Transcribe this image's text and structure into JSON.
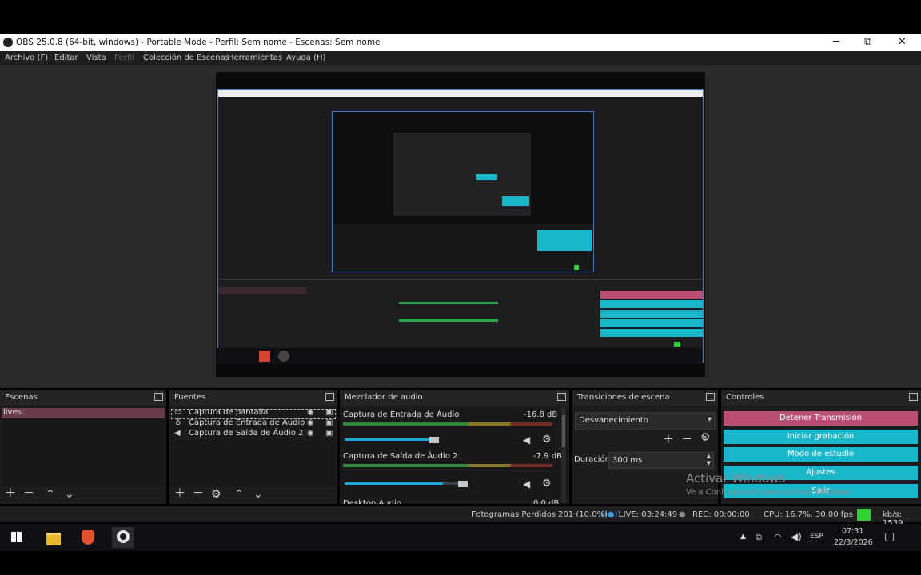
{
  "window": {
    "title": "OBS 25.0.8 (64-bit, windows) - Portable Mode - Perfil: Sem nome - Escenas: Sem nome",
    "minimize": "─",
    "maximize": "⧉",
    "close": "✕"
  },
  "menu": [
    "Archivo (F)",
    "Editar",
    "Vista",
    "Perfil",
    "Colección de Escenas",
    "Herramientas",
    "Ayuda (H)"
  ],
  "docks": {
    "scenes": {
      "title": "Escenas",
      "items": [
        "lives"
      ]
    },
    "sources": {
      "title": "Fuentes",
      "items": [
        "Captura de pantalla",
        "Captura de Entrada de Áudio",
        "Captura de Saída de Áudio 2"
      ]
    },
    "mixer": {
      "title": "Mezclador de audio",
      "channels": [
        {
          "name": "Captura de Entrada de Áudio",
          "db": "-16.8 dB",
          "volume": 0.96
        },
        {
          "name": "Captura de Saída de Áudio 2",
          "db": "-7.9 dB",
          "volume": 0.82
        },
        {
          "name": "Desktop Áudio",
          "db": "0.0 dB"
        }
      ],
      "scale": [
        "-60",
        "-55",
        "-50",
        "-45",
        "-40",
        "-35",
        "-30",
        "-25",
        "-20",
        "-15",
        "-10",
        "-5",
        "0"
      ]
    },
    "transitions": {
      "title": "Transiciones de escena",
      "selected": "Desvanecimiento",
      "duration_label": "Duración",
      "duration_value": "300 ms"
    },
    "controls": {
      "title": "Controles",
      "buttons": [
        "Detener Transmisión",
        "Iniciar grabación",
        "Modo de estudio",
        "Ajustes",
        "Salir"
      ]
    }
  },
  "status": {
    "dropped": "Fotogramas Perdidos 201 (10.0%)",
    "live": "LIVE: 03:24:49",
    "rec": "REC: 00:00:00",
    "cpu": "CPU: 16.7%, 30.00 fps",
    "kbps": "kb/s: 1539"
  },
  "watermark": {
    "line1": "Activar Windows",
    "line2": "Ve a Configuración para activar Windows."
  },
  "taskbar": {
    "lang": "ESP",
    "time": "07:31",
    "date": "22/3/2026"
  },
  "colors": {
    "accent_cyan": "#18b7cc",
    "stop_pink": "#b94f74",
    "bg_dark": "#1d1d1f"
  }
}
